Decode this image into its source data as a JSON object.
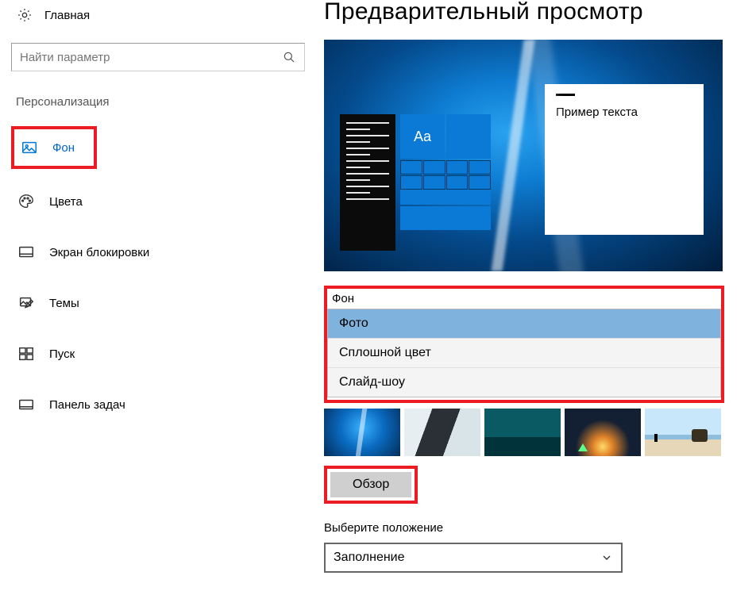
{
  "sidebar": {
    "home_label": "Главная",
    "search_placeholder": "Найти параметр",
    "section_title": "Персонализация",
    "items": [
      {
        "label": "Фон",
        "selected": true
      },
      {
        "label": "Цвета"
      },
      {
        "label": "Экран блокировки"
      },
      {
        "label": "Темы"
      },
      {
        "label": "Пуск"
      },
      {
        "label": "Панель задач"
      }
    ]
  },
  "main": {
    "page_title": "Предварительный просмотр",
    "sample_text": "Пример текста",
    "tile_aa": "Aa",
    "background_section": {
      "label": "Фон",
      "options": [
        "Фото",
        "Сплошной цвет",
        "Слайд-шоу"
      ],
      "selected": "Фото"
    },
    "browse_label": "Обзор",
    "position_label": "Выберите положение",
    "position_value": "Заполнение"
  }
}
